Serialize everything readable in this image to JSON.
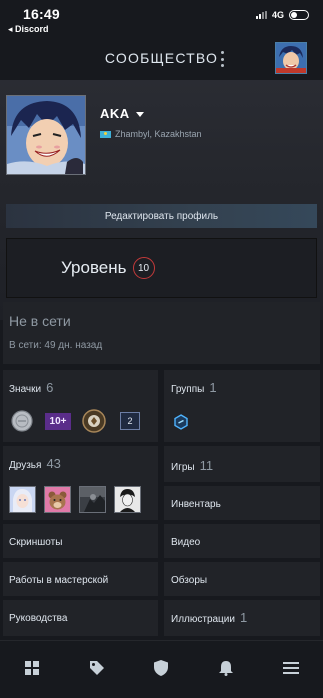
{
  "status_bar": {
    "time": "16:49",
    "back_app": "◂ Discord",
    "network": "4G"
  },
  "header": {
    "title": "СООБЩЕСТВО"
  },
  "profile": {
    "username": "AKA",
    "location": "Zhambyl, Kazakhstan",
    "edit_label": "Редактировать профиль",
    "level_label": "Уровень",
    "level_value": "10",
    "status": "Не в сети",
    "last_online": "В сети: 49 дн. назад"
  },
  "tiles": {
    "badges": {
      "label": "Значки",
      "count": "6",
      "items": [
        "silver-coin-badge-icon",
        "10plus-badge-icon",
        "medal-badge-icon",
        "level-2-badge-icon"
      ],
      "item_2_text": "10+",
      "item_4_text": "2"
    },
    "groups": {
      "label": "Группы",
      "count": "1"
    },
    "friends": {
      "label": "Друзья",
      "count": "43"
    },
    "games": {
      "label": "Игры",
      "count": "11"
    },
    "inventory": {
      "label": "Инвентарь"
    },
    "screenshots": {
      "label": "Скриншоты"
    },
    "videos": {
      "label": "Видео"
    },
    "workshop": {
      "label": "Работы в мастерской"
    },
    "reviews": {
      "label": "Обзоры"
    },
    "guides": {
      "label": "Руководства"
    },
    "artwork": {
      "label": "Иллюстрации",
      "count": "1"
    }
  },
  "nav": [
    "store-icon",
    "tag-icon",
    "shield-icon",
    "bell-icon",
    "menu-icon"
  ],
  "colors": {
    "level_ring": "#c43a3a",
    "accent": "#4a7fa8",
    "background": "#17191e",
    "tile": "#212328"
  }
}
